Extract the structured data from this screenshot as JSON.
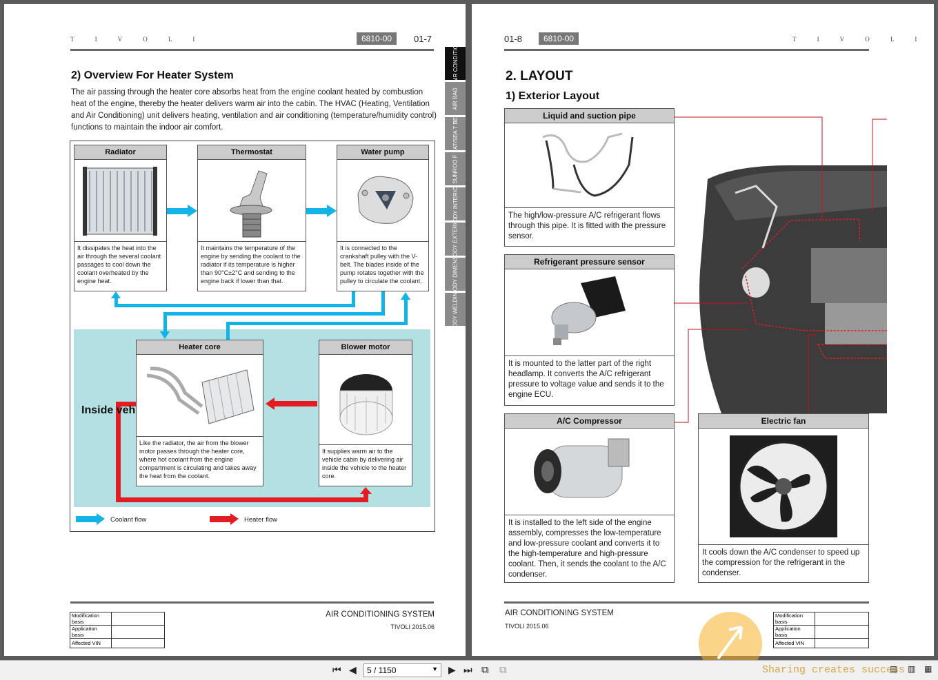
{
  "left_page": {
    "brand": "T I V O L I",
    "code": "6810-00",
    "page_number": "01-7",
    "section_title": "2) Overview For Heater System",
    "intro": "The air passing through the heater core absorbs heat from the engine coolant heated by combustion heat of the engine, thereby the heater delivers warm air into the cabin. The HVAC (Heating, Ventilation and Air Conditioning) unit delivers heating, ventilation and air conditioning (temperature/humidity control) functions to maintain the indoor air comfort.",
    "cards": [
      {
        "title": "Radiator",
        "desc": "It dissipates the heat into the air through the several coolant passages to cool down the coolant overheated by the engine heat."
      },
      {
        "title": "Thermostat",
        "desc": "It maintains the temperature of the engine by sending the coolant to the radiator if its temperature is higher than 90°C±2°C and sending to the engine back if lower than that."
      },
      {
        "title": "Water pump",
        "desc": "It is connected to the crankshaft pulley with the V-belt. The blades inside of the pump rotates together with the pulley to circulate the coolant."
      },
      {
        "title": "Heater core",
        "desc": "Like the radiator, the air from the blower motor passes through the heater core, where hot coolant from the engine compartment is circulating and takes away the heat from the coolant."
      },
      {
        "title": "Blower motor",
        "desc": "It supplies warm air to the vehicle cabin by delivering air inside the vehicle to the heater core."
      }
    ],
    "inside_vehicle": "Inside vehicle",
    "legend": {
      "coolant": "Coolant flow",
      "heater": "Heater flow"
    },
    "footer": {
      "title": "AIR CONDITIONING SYSTEM",
      "sub": "TIVOLI 2015.06",
      "rows": [
        "Modification basis",
        "Application basis",
        "Affected VIN"
      ]
    },
    "side_tabs": [
      "AIR CONDITIO",
      "AIR BAG",
      "SEAT/SEA T BELT",
      "SUNROO F",
      "BODY INTERIOR",
      "BODY EXTERIO",
      "BODY DIMENSI",
      "BODY WELDING"
    ]
  },
  "right_page": {
    "brand": "T I V O L I",
    "code": "6810-00",
    "page_number": "01-8",
    "section_title": "2. LAYOUT",
    "sub_title": "1) Exterior Layout",
    "cards": [
      {
        "title": "Liquid and suction pipe",
        "desc": "The high/low-pressure A/C refrigerant flows through this pipe. It is fitted with the pressure sensor."
      },
      {
        "title": "Refrigerant pressure sensor",
        "desc": "It is mounted to the latter part of the right headlamp. It converts the A/C refrigerant pressure to voltage value and sends it to the engine ECU."
      },
      {
        "title": "A/C Compressor",
        "desc": "It is installed to the left side of the engine assembly, compresses the low-temperature and low-pressure coolant and converts it to the high-temperature and high-pressure coolant. Then, it sends the coolant to the A/C condenser."
      },
      {
        "title": "Electric fan",
        "desc": "It cools down the A/C condenser to speed up the compression for the refrigerant in the condenser."
      }
    ],
    "footer": {
      "title": "AIR CONDITIONING SYSTEM",
      "sub": "TIVOLI 2015.06",
      "rows": [
        "Modification basis",
        "Application basis",
        "Affected VIN"
      ]
    }
  },
  "toolbar": {
    "page_field": "5 / 1150"
  },
  "watermark": {
    "text": "Sharing creates success"
  },
  "colors": {
    "coolant": "#12b3e6",
    "heater": "#e31b23",
    "inside_bg": "#b2e0e3",
    "leader": "#c0161e"
  }
}
